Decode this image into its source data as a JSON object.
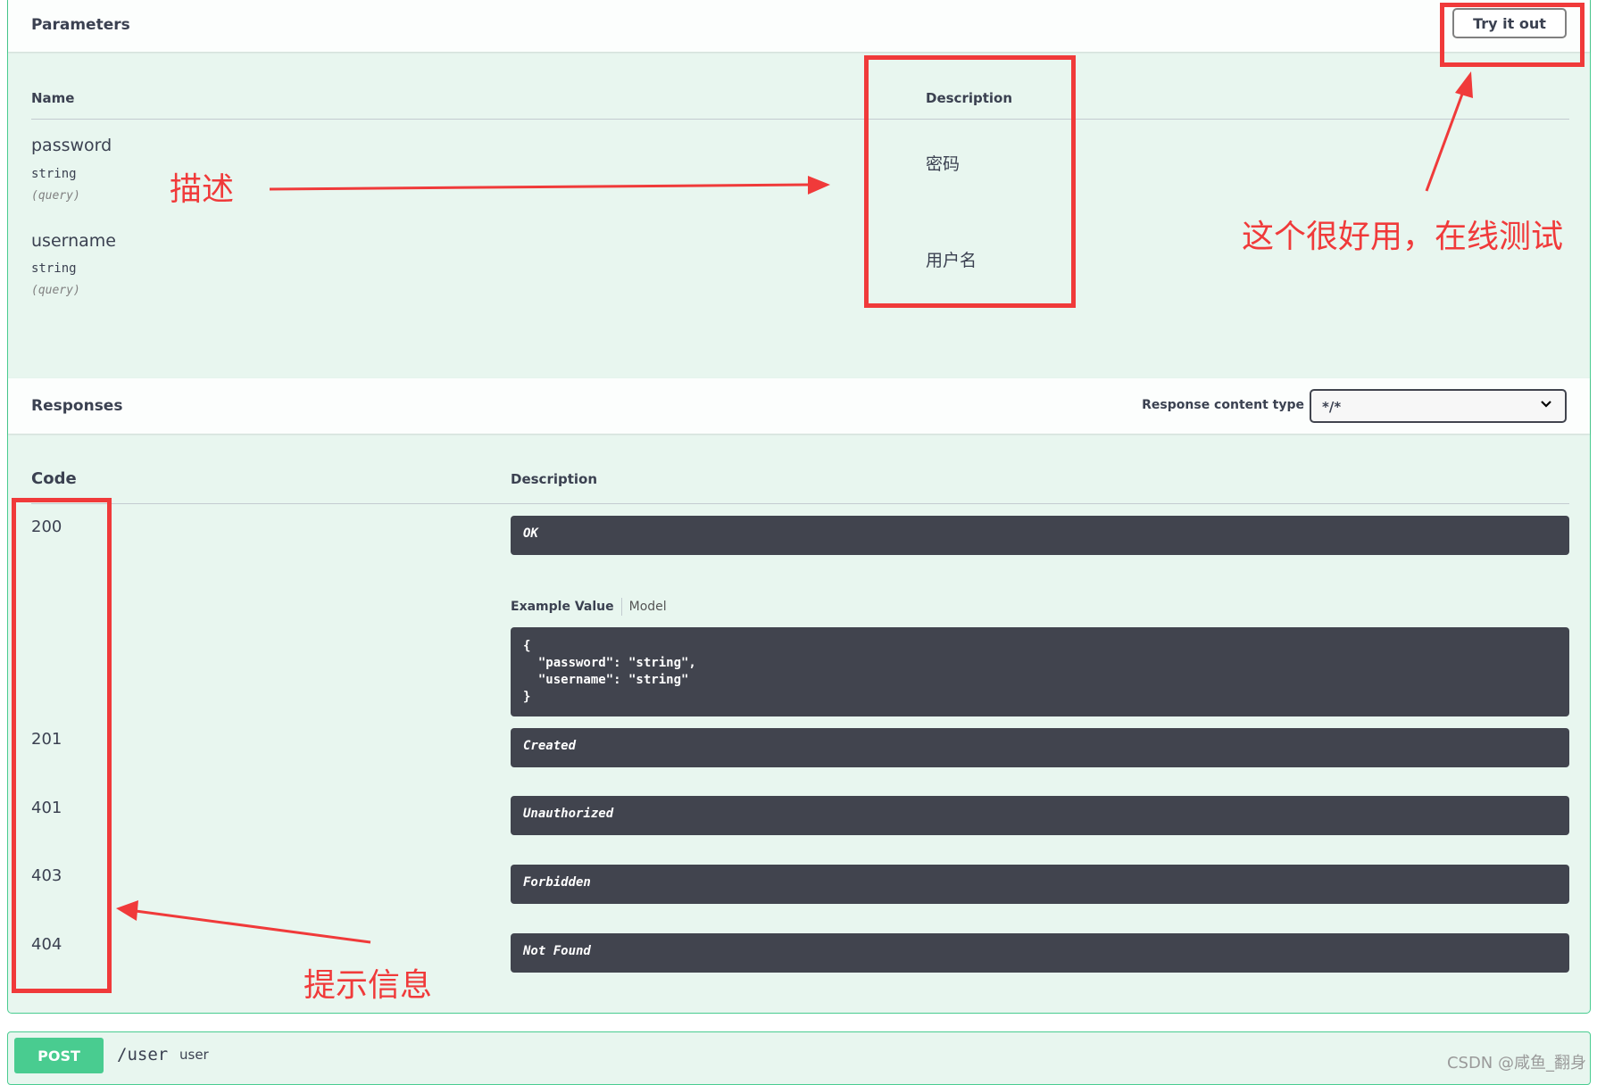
{
  "parameters": {
    "title": "Parameters",
    "try_label": "Try it out",
    "col_name": "Name",
    "col_description": "Description",
    "items": [
      {
        "name": "password",
        "type": "string",
        "in": "(query)",
        "description": "密码"
      },
      {
        "name": "username",
        "type": "string",
        "in": "(query)",
        "description": "用户名"
      }
    ]
  },
  "responses": {
    "title": "Responses",
    "content_type_label": "Response content type",
    "content_type_value": "*/*",
    "col_code": "Code",
    "col_description": "Description",
    "items": [
      {
        "code": "200",
        "description": "OK"
      },
      {
        "code": "201",
        "description": "Created"
      },
      {
        "code": "401",
        "description": "Unauthorized"
      },
      {
        "code": "403",
        "description": "Forbidden"
      },
      {
        "code": "404",
        "description": "Not Found"
      }
    ],
    "example_tab": "Example Value",
    "model_tab": "Model",
    "example_json": "{\n  \"password\": \"string\",\n  \"username\": \"string\"\n}"
  },
  "next_op": {
    "method": "POST",
    "path": "/user",
    "summary": "user"
  },
  "annotations": {
    "describe": "描述",
    "try_tip": "这个很好用，在线测试",
    "hint": "提示信息",
    "color": "#f03a3a"
  },
  "watermark": "CSDN @咸鱼_翻身",
  "colors": {
    "accent": "#49cc90",
    "panel": "#e8f6ef",
    "code_bg": "#41444e"
  }
}
